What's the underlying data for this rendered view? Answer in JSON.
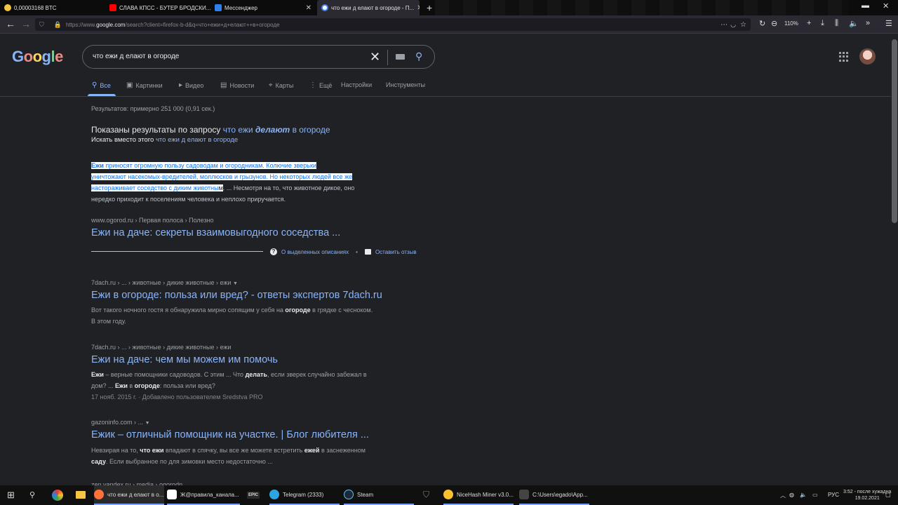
{
  "browser": {
    "tabs": [
      {
        "title": "0,00003168 BTC",
        "color": "#f4c542"
      },
      {
        "title": "СЛАВА КПСС - БУТЕР БРОДСКИ...",
        "color": "#ff0000"
      },
      {
        "title": "Мессенджер",
        "color": "#2f80ed"
      },
      {
        "title": "что ежи д елают в огороде - П...",
        "color": "#4285f4"
      }
    ],
    "new_tab": "+",
    "url_prefix": "https://www.",
    "url_domain": "google.com",
    "url_rest": "/search?client=firefox-b-d&q=что+ежи+д+елают++в+огороде",
    "zoom": "110%"
  },
  "google": {
    "logo": [
      "G",
      "o",
      "o",
      "g",
      "l",
      "e"
    ],
    "logo_colors": [
      "#8ab4f8",
      "#f28b82",
      "#fdd663",
      "#8ab4f8",
      "#81c995",
      "#f28b82"
    ],
    "query": "что ежи д елают  в огороде",
    "tabs": [
      {
        "icon": "search-icon",
        "glyph": "🔍",
        "label": "Все"
      },
      {
        "icon": "image-icon",
        "glyph": "▣",
        "label": "Картинки"
      },
      {
        "icon": "video-icon",
        "glyph": "▶",
        "label": "Видео"
      },
      {
        "icon": "news-icon",
        "glyph": "▤",
        "label": "Новости"
      },
      {
        "icon": "map-pin-icon",
        "glyph": "⌖",
        "label": "Карты"
      },
      {
        "icon": "more-vert-icon",
        "glyph": "⋮",
        "label": "Ещё"
      },
      {
        "icon": "",
        "glyph": "",
        "label": "Настройки"
      },
      {
        "icon": "",
        "glyph": "",
        "label": "Инструменты"
      }
    ]
  },
  "results": {
    "stats": "Результатов: примерно 251 000 (0,91 сек.)",
    "spell": {
      "shown_prefix": "Показаны результаты по запросу",
      "corrected_1": "что ежи",
      "corrected_bold": "делают",
      "corrected_2": "в огороде",
      "instead_prefix": "Искать вместо этого",
      "instead_link": "что ежи д елают в огороде"
    },
    "featured": {
      "bold": "Ежи",
      "line1": " приносят огромную пользу садоводам и огородникам. Колючие зверьки",
      "line2": "уничтожают насекомых-вредителей, моллюсков и грызунов. Но некоторых людей все же",
      "line3": "настораживает соседство с диким животны",
      "line3_white": "м",
      "line3_rest": ". ... Несмотря на то, что животное дикое, оно",
      "line4": "нередко приходит к поселениям человека и неплохо приручается.",
      "crumb": "www.ogorod.ru › Первая полоса › Полезно",
      "title": "Ежи на даче: секреты взаимовыгодного соседства ...",
      "about": "О выделенных описаниях",
      "dot": "•",
      "feedback": "Оставить отзыв"
    },
    "items": [
      {
        "crumb": "7dach.ru › ... › животные › дикие животные › ежи",
        "title": "Ежи в огороде: польза или вред? - ответы экспертов 7dach.ru",
        "s1a": "Вот такого ночного гостя я обнаружила мирно сопящим у себя на ",
        "s1b": "огороде",
        "s1c": " в грядке с чесноком.",
        "s2": "В этом году."
      },
      {
        "crumb": "7dach.ru › ... › животные › дикие животные › ежи",
        "title": "Ежи на даче: чем мы можем им помочь",
        "s1a": "Ежи",
        "s1b": " – верные помощники садоводов. С этим ... Что ",
        "s1c": "делать",
        "s1d": ", если зверек случайно забежал в",
        "s2a": "дом? ... ",
        "s2b": "Ежи",
        "s2c": " в ",
        "s2d": "огороде",
        "s2e": ": польза или вред?",
        "s3": "17 нояб. 2015 г. · Добавлено пользователем Sredstva PRO"
      },
      {
        "crumb": "gazoninfo.com › ...",
        "title": "Ежик – отличный помощник на участке. | Блог любителя ...",
        "s1a": "Невзирая на то, ",
        "s1b": "что ежи",
        "s1c": " впадают в спячку, вы все же можете встретить ",
        "s1d": "ежей",
        "s1e": " в заснеженном",
        "s2a": "саду",
        "s2b": ". Если выбранное по для зимовки место недостаточно ..."
      }
    ],
    "cut_crumb": "zen.yandex.ru › media › ogorodn..."
  },
  "taskbar": {
    "apps": [
      {
        "label": "что ежи д елают в о...",
        "color": "#ff7139"
      },
      {
        "label": "Ж@правила_канала...",
        "color": "#ffffff"
      },
      {
        "label": "EPIC",
        "color": "#2a2a2a"
      },
      {
        "label": "Telegram (2333)",
        "color": "#2ca5e0"
      },
      {
        "label": "Steam",
        "color": "#1b2838"
      },
      {
        "label": "NiceHash Miner v3.0...",
        "color": "#fbc02d"
      },
      {
        "label": "C:\\Users\\egado\\App...",
        "color": "#444444"
      }
    ],
    "lang": "РУС",
    "time": "3:52 - после хужадна",
    "date": "19.02.2021"
  }
}
